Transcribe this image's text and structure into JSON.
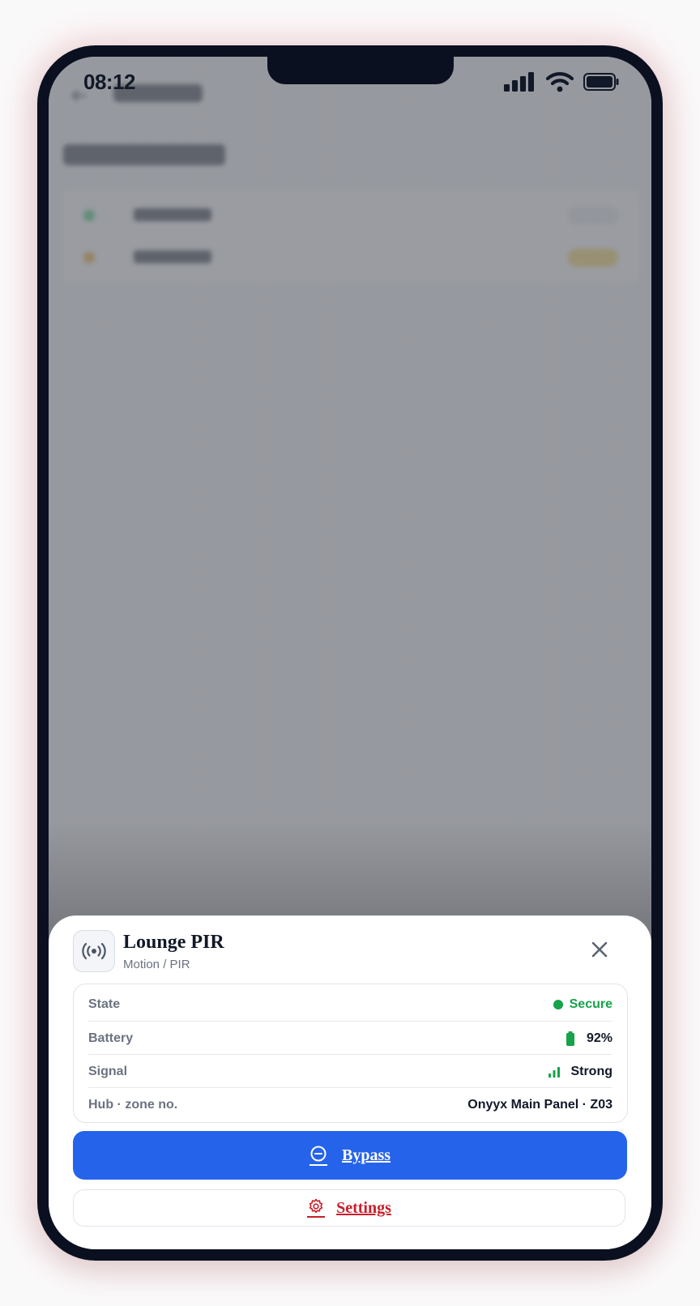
{
  "status_bar": {
    "time": "08:12",
    "icons": [
      "cellular-signal-icon",
      "wifi-icon",
      "battery-icon"
    ]
  },
  "background_screen": {
    "state": "blurred behind modal scrim",
    "rows": [
      {
        "status_color": "#22c55e",
        "badge_color": "#e5e7eb"
      },
      {
        "status_color": "#f59e0b",
        "badge_color": "#fcd34d"
      }
    ]
  },
  "sheet": {
    "icon": "wireless-sensor-icon",
    "title": "Lounge PIR",
    "subtitle": "Motion / PIR",
    "close_icon": "close-icon",
    "details": [
      {
        "label": "State",
        "value": "Secure",
        "indicator": "green-dot",
        "value_color": "#16a34a"
      },
      {
        "label": "Battery",
        "value": "92%",
        "indicator": "battery-icon",
        "level_percent": 92
      },
      {
        "label": "Signal",
        "value": "Strong",
        "indicator": "signal-bars-icon"
      },
      {
        "label": "Hub · zone no.",
        "value": "Onyyx Main Panel · Z03"
      }
    ],
    "primary_action": {
      "label": "Bypass",
      "icon": "minus-circle-icon",
      "color": "#2563eb"
    },
    "secondary_action": {
      "label": "Settings",
      "icon": "gear-icon",
      "color": "#c81e2b"
    }
  }
}
